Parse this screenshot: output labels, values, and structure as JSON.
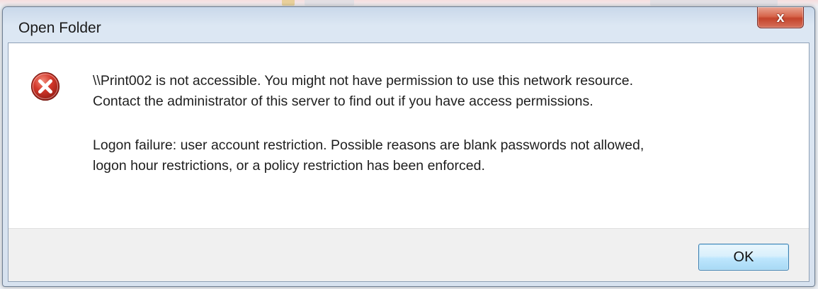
{
  "dialog": {
    "title": "Open Folder",
    "close_label": "x",
    "icon": "error-icon",
    "message_lines": [
      "\\\\Print002 is not accessible. You might not have permission to use this network resource.",
      "Contact the administrator of this server to find out if you have access permissions."
    ],
    "detail_lines": [
      "Logon failure: user account restriction. Possible reasons are blank passwords not allowed,",
      "logon hour restrictions, or a policy restriction has been enforced."
    ],
    "ok_label": "OK"
  },
  "colors": {
    "error_red": "#d4382b",
    "close_red": "#c4442c",
    "default_button_border": "#3c7fb1"
  }
}
